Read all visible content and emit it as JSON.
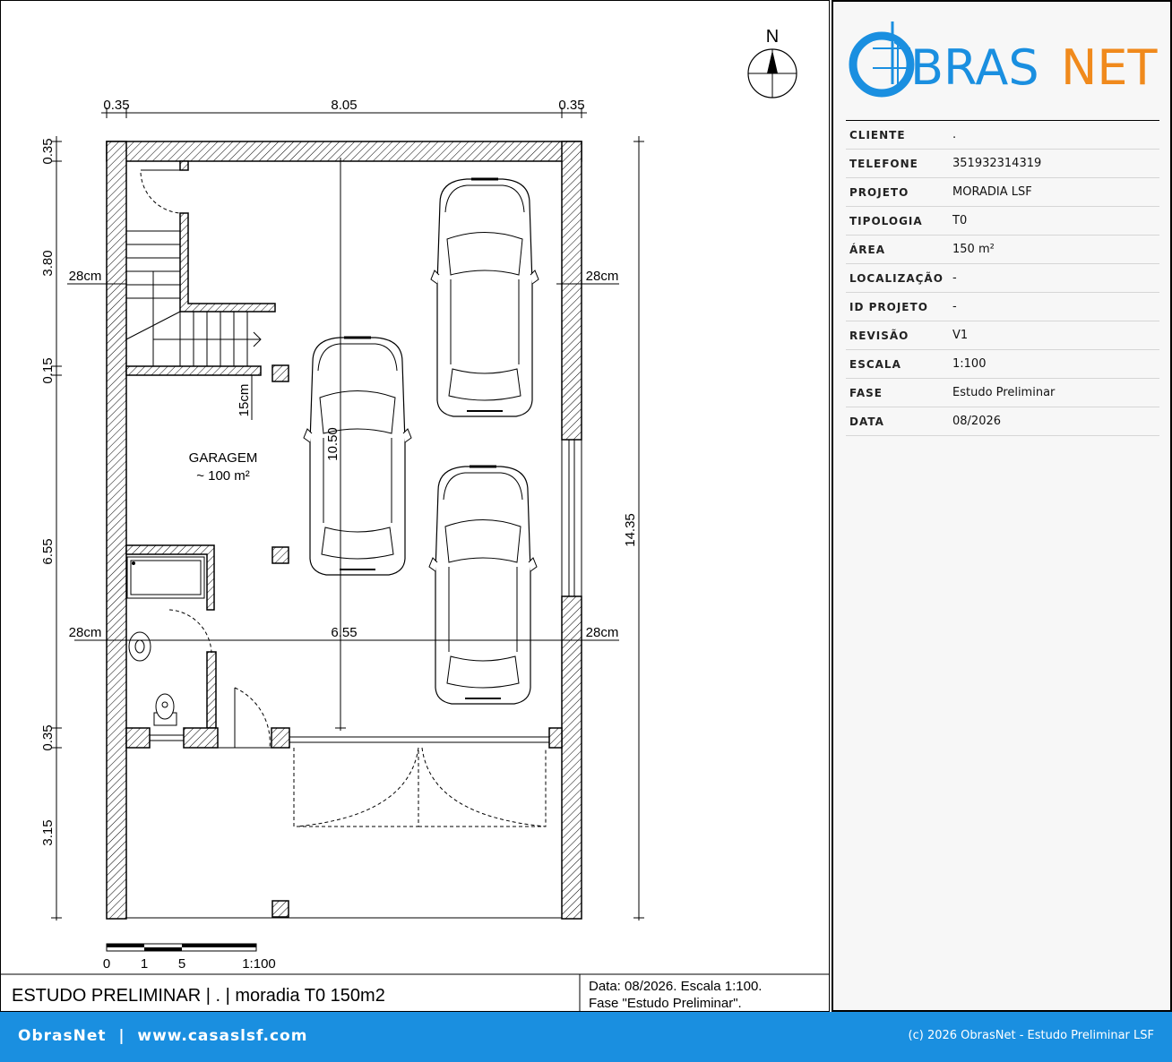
{
  "drawing": {
    "north_label": "N",
    "dims": {
      "top_left": "0.35",
      "top_mid": "8.05",
      "top_right": "0.35",
      "left_1": "0.35",
      "left_2": "3.80",
      "left_3": "0.15",
      "left_4": "6.55",
      "left_5": "0.35",
      "left_6": "3.15",
      "right_total": "14.35",
      "inner_v": "10.50",
      "inner_h": "6.55",
      "wall_left_top": "28cm",
      "wall_right_top": "28cm",
      "wall_left_bottom": "28cm",
      "wall_right_bottom": "28cm",
      "slab": "15cm"
    },
    "room_name": "GARAGEM",
    "room_area": "~ 100 m²",
    "scalebar": {
      "t0": "0",
      "t1": "1",
      "t5": "5",
      "scale": "1:100"
    },
    "title_block": {
      "title": "ESTUDO PRELIMINAR | . | moradia T0 150m2",
      "note_line1": "Data: 08/2026. Escala 1:100.",
      "note_line2": "Fase \"Estudo Preliminar\"."
    }
  },
  "panel": {
    "logo_part1": "BRAS",
    "logo_part2": "NET",
    "logo_colors": {
      "blue": "#1a8fe0",
      "orange": "#f08a1c"
    },
    "rows": [
      {
        "key": "CLIENTE",
        "value": "."
      },
      {
        "key": "TELEFONE",
        "value": "351932314319"
      },
      {
        "key": "PROJETO",
        "value": "MORADIA LSF"
      },
      {
        "key": "TIPOLOGIA",
        "value": "T0"
      },
      {
        "key": "ÁREA",
        "value": "150 m²"
      },
      {
        "key": "LOCALIZAÇÃO",
        "value": "-"
      },
      {
        "key": "ID PROJETO",
        "value": "-"
      },
      {
        "key": "REVISÃO",
        "value": "V1"
      },
      {
        "key": "ESCALA",
        "value": "1:100"
      },
      {
        "key": "FASE",
        "value": "Estudo Preliminar"
      },
      {
        "key": "DATA",
        "value": "08/2026"
      }
    ]
  },
  "footer": {
    "left": "ObrasNet  |  www.casaslsf.com",
    "right": "(c) 2026 ObrasNet - Estudo Preliminar LSF"
  }
}
